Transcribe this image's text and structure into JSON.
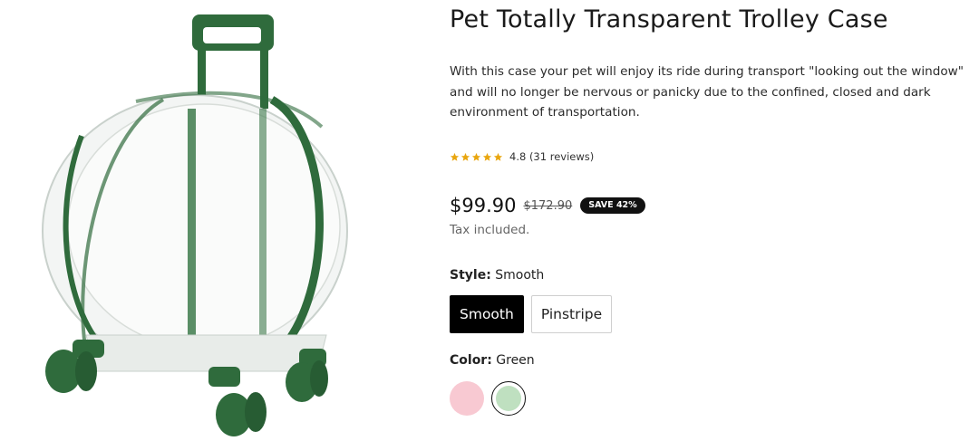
{
  "product": {
    "title": "Pet Totally Transparent Trolley Case",
    "description": "With this case your pet will enjoy its ride during transport \"looking out the window\" and will no longer be nervous or panicky due to the confined, closed and dark environment of transportation.",
    "rating": {
      "value": 4.8,
      "stars": 5,
      "text": "4.8 (31 reviews)",
      "star_color": "#e9a60f"
    },
    "price": "$99.90",
    "compare_price": "$172.90",
    "save_badge": "SAVE 42%",
    "tax_note": "Tax included."
  },
  "options": {
    "style": {
      "label": "Style:",
      "selected": "Smooth",
      "values": [
        "Smooth",
        "Pinstripe"
      ]
    },
    "color": {
      "label": "Color:",
      "selected": "Green",
      "swatches": [
        {
          "name": "Pink",
          "color": "#f8c9d2"
        },
        {
          "name": "Green",
          "color": "#bfe0c0"
        }
      ]
    }
  },
  "colors": {
    "accent": "#000000",
    "product_green": "#2f6b3c"
  }
}
